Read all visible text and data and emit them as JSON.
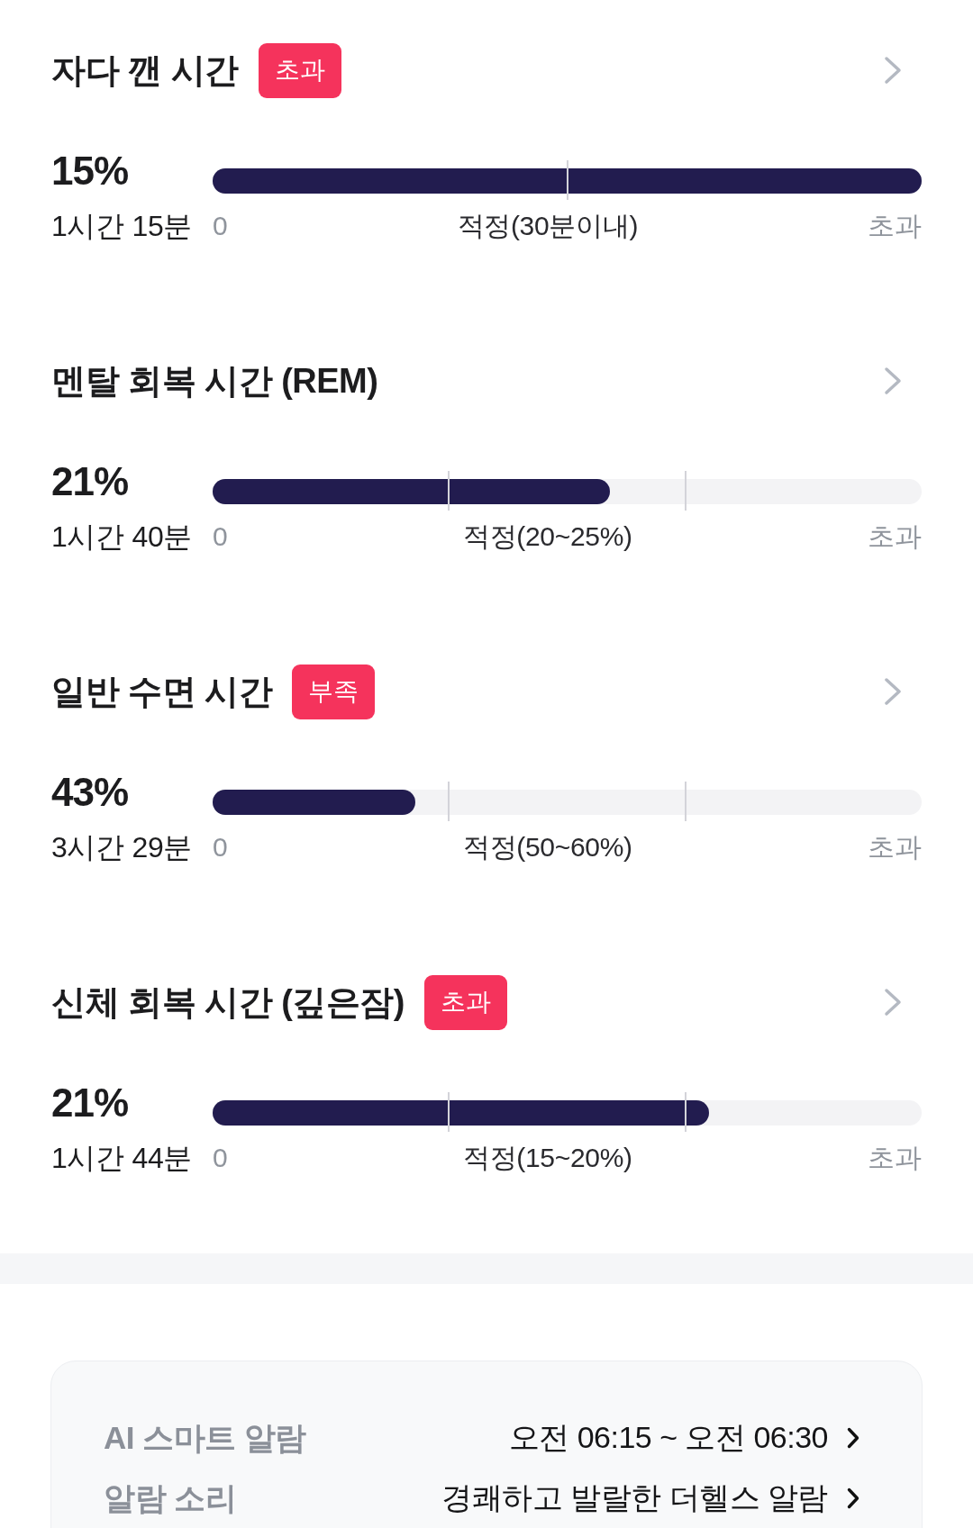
{
  "sections": [
    {
      "title": "자다 깬 시간",
      "badge": "초과",
      "percent": "15%",
      "duration": "1시간 15분",
      "kind": "limit",
      "level": 1,
      "axis": {
        "start": "0",
        "target": "적정(30분이내)",
        "end": "초과"
      }
    },
    {
      "title": "멘탈 회복 시간 (REM)",
      "percent": "21%",
      "duration": "1시간 40분",
      "kind": "range",
      "level": 0.56,
      "axis": {
        "start": "0",
        "target": "적정(20~25%)",
        "end": "초과"
      }
    },
    {
      "title": "일반 수면 시간",
      "badge": "부족",
      "percent": "43%",
      "duration": "3시간 29분",
      "kind": "range",
      "level": 0.286,
      "axis": {
        "start": "0",
        "target": "적정(50~60%)",
        "end": "초과"
      }
    },
    {
      "title": "신체 회복 시간 (깊은잠)",
      "badge": "초과",
      "percent": "21%",
      "duration": "1시간 44분",
      "kind": "range",
      "level": 0.7,
      "axis": {
        "start": "0",
        "target": "적정(15~20%)",
        "end": "초과"
      }
    }
  ],
  "settings_card": {
    "rows": [
      {
        "label": "AI 스마트 알람",
        "value": "오전 06:15 ~ 오전 06:30"
      },
      {
        "label": "알람 소리",
        "value": "경쾌하고 발랄한 더헬스 알람"
      }
    ]
  }
}
